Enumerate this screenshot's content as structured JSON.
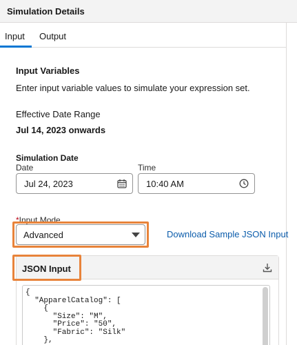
{
  "header": {
    "title": "Simulation Details"
  },
  "tabs": [
    {
      "label": "Input",
      "active": true
    },
    {
      "label": "Output",
      "active": false
    }
  ],
  "input_variables": {
    "title": "Input Variables",
    "description": "Enter input variable values to simulate your expression set."
  },
  "effective_range": {
    "label": "Effective Date Range",
    "value": "Jul 14, 2023  onwards"
  },
  "simulation_date": {
    "title": "Simulation Date",
    "date_label": "Date",
    "date_value": "Jul 24, 2023",
    "time_label": "Time",
    "time_value": "10:40 AM"
  },
  "input_mode": {
    "required_mark": "*",
    "label": "Input Mode",
    "selected": "Advanced",
    "download_link": "Download Sample JSON Input"
  },
  "json_input": {
    "title": "JSON Input",
    "code": "{\n  \"ApparelCatalog\": [\n    {\n      \"Size\": \"M\",\n      \"Price\": \"50\",\n      \"Fabric\": \"Silk\"\n    },"
  },
  "colors": {
    "accent": "#0176d3",
    "link": "#0b5cab",
    "highlight": "#e8833a",
    "required": "#ba0517"
  },
  "icons": [
    "calendar-icon",
    "clock-icon",
    "chevron-down-icon",
    "download-icon"
  ]
}
